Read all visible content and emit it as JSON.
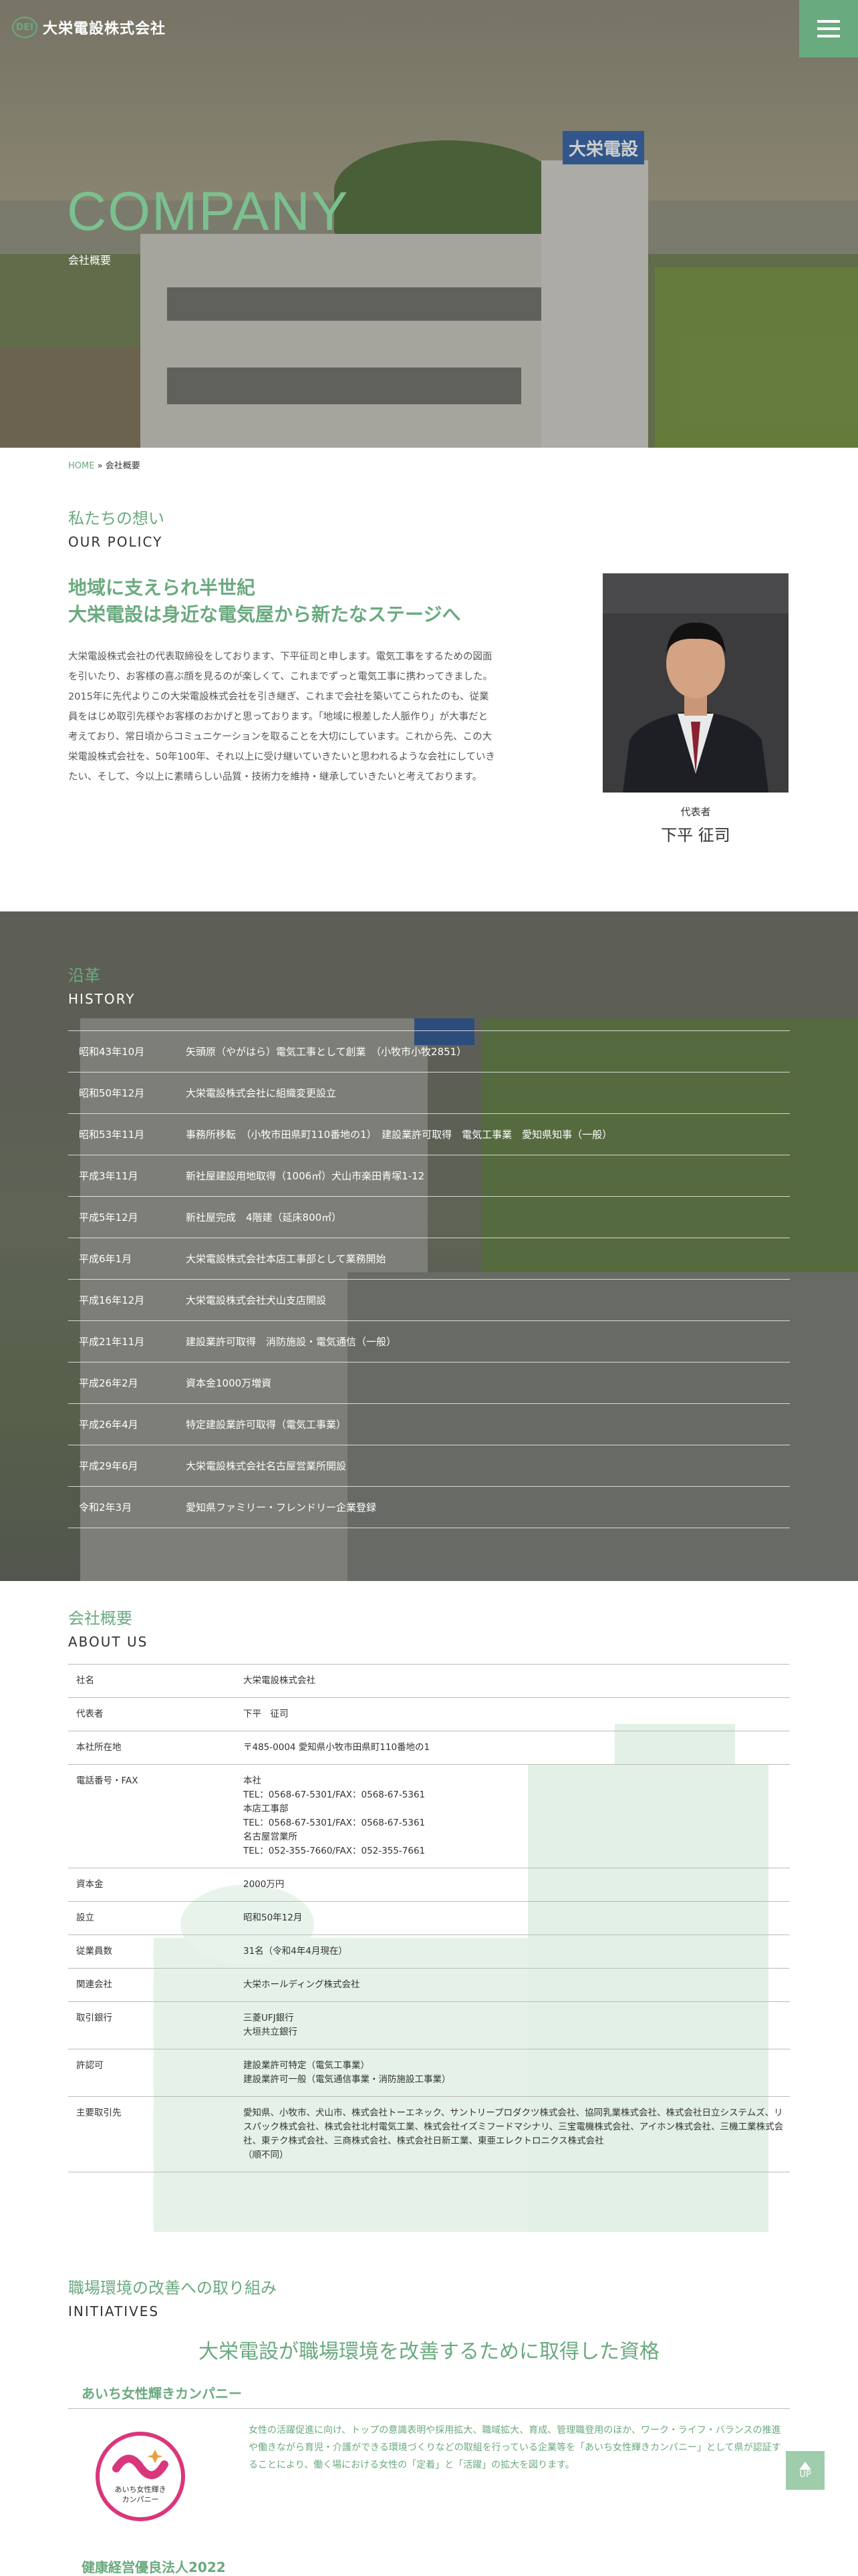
{
  "header": {
    "logo_mark": "DEI",
    "company_name": "大栄電設株式会社",
    "menu_icon": "hamburger-icon"
  },
  "hero": {
    "title": "COMPANY",
    "subtitle": "会社概要",
    "sign_text": "大栄電設"
  },
  "breadcrumb": {
    "home": "HOME",
    "separator": "»",
    "current": "会社概要"
  },
  "policy": {
    "title_ja": "私たちの想い",
    "title_en": "OUR POLICY",
    "lead_line1": "地域に支えられ半世紀",
    "lead_line2": "大栄電設は身近な電気屋から新たなステージへ",
    "body": "大栄電設株式会社の代表取締役をしております、下平征司と申します。電気工事をするための図面を引いたり、お客様の喜ぶ顔を見るのが楽しくて、これまでずっと電気工事に携わってきました。2015年に先代よりこの大栄電設株式会社を引き継ぎ、これまで会社を築いてこられたのも、従業員をはじめ取引先様やお客様のおかげと思っております。「地域に根差した人脈作り」が大事だと考えており、常日頃からコミュニケーションを取ることを大切にしています。これから先、この大栄電設株式会社を、50年100年、それ以上に受け継いていきたいと思われるような会社にしていきたい、そして、今以上に素晴らしい品質・技術力を維持・継承していきたいと考えております。",
    "photo_caption": "代表者",
    "representative": "下平 征司"
  },
  "history": {
    "title_ja": "沿革",
    "title_en": "HISTORY",
    "rows": [
      {
        "date": "昭和43年10月",
        "event": "矢頭原（やがはら）電気工事として創業　（小牧市小牧2851）"
      },
      {
        "date": "昭和50年12月",
        "event": "大栄電設株式会社に組織変更設立"
      },
      {
        "date": "昭和53年11月",
        "event": "事務所移転　（小牧市田県町110番地の1）　建設業許可取得　電気工事業　愛知県知事（一般）"
      },
      {
        "date": "平成3年11月",
        "event": "新社屋建設用地取得（1006㎡）犬山市楽田青塚1-12"
      },
      {
        "date": "平成5年12月",
        "event": "新社屋完成　4階建（延床800㎡）"
      },
      {
        "date": "平成6年1月",
        "event": "大栄電設株式会社本店工事部として業務開始"
      },
      {
        "date": "平成16年12月",
        "event": "大栄電設株式会社犬山支店開設"
      },
      {
        "date": "平成21年11月",
        "event": "建設業許可取得　消防施設・電気通信（一般）"
      },
      {
        "date": "平成26年2月",
        "event": "資本金1000万増資"
      },
      {
        "date": "平成26年4月",
        "event": "特定建設業許可取得（電気工事業）"
      },
      {
        "date": "平成29年6月",
        "event": "大栄電設株式会社名古屋営業所開設"
      },
      {
        "date": "令和2年3月",
        "event": "愛知県ファミリー・フレンドリー企業登録"
      }
    ]
  },
  "about": {
    "title_ja": "会社概要",
    "title_en": "ABOUT US",
    "rows": [
      {
        "label": "社名",
        "value": "大栄電設株式会社"
      },
      {
        "label": "代表者",
        "value": "下平　征司"
      },
      {
        "label": "本社所在地",
        "value": "〒485-0004 愛知県小牧市田県町110番地の1"
      },
      {
        "label": "電話番号・FAX",
        "value": "本社\nTEL：0568-67-5301/FAX：0568-67-5361\n本店工事部\nTEL：0568-67-5301/FAX：0568-67-5361\n名古屋営業所\nTEL：052-355-7660/FAX：052-355-7661"
      },
      {
        "label": "資本金",
        "value": "2000万円"
      },
      {
        "label": "設立",
        "value": "昭和50年12月"
      },
      {
        "label": "従業員数",
        "value": "31名（令和4年4月現在）"
      },
      {
        "label": "関連会社",
        "value": "大栄ホールディング株式会社"
      },
      {
        "label": "取引銀行",
        "value": "三菱UFJ銀行\n大垣共立銀行"
      },
      {
        "label": "許認可",
        "value": "建設業許可特定（電気工事業）\n建設業許可一般（電気通信事業・消防施設工事業）"
      },
      {
        "label": "主要取引先",
        "value": "愛知県、小牧市、犬山市、株式会社トーエネック、サントリープロダクツ株式会社、協同乳業株式会社、株式会社日立システムズ、リスパック株式会社、株式会社北村電気工業、株式会社イズミフードマシナリ、三宝電機株式会社、アイホン株式会社、三機工業株式会社、東テク株式会社、三商株式会社、株式会社日新工業、東亜エレクトロニクス株式会社\n（順不同）"
      }
    ]
  },
  "initiatives": {
    "title_ja": "職場環境の改善への取り組み",
    "title_en": "INITIATIVES",
    "heading": "大栄電設が職場環境を改善するために取得した資格",
    "aichi_title": "あいち女性輝きカンパニー",
    "aichi_logo_line1": "あいち女性輝き",
    "aichi_logo_line2": "カンパニー",
    "aichi_text": "女性の活躍促進に向け、トップの意識表明や採用拡大、職域拡大、育成、管理職登用のほか、ワーク・ライフ・バランスの推進や働きながら育児・介護ができる環境づくりなどの取組を行っている企業等を「あいち女性輝きカンパニー」として県が認証することにより、働く場における女性の「定着」と「活躍」の拡大を図ります。",
    "health_title": "健康経営優良法人2022"
  },
  "up_button": {
    "label": "UP",
    "icon": "arrow-up-icon"
  },
  "colors": {
    "accent": "#6aaa7f",
    "text": "#333333"
  }
}
